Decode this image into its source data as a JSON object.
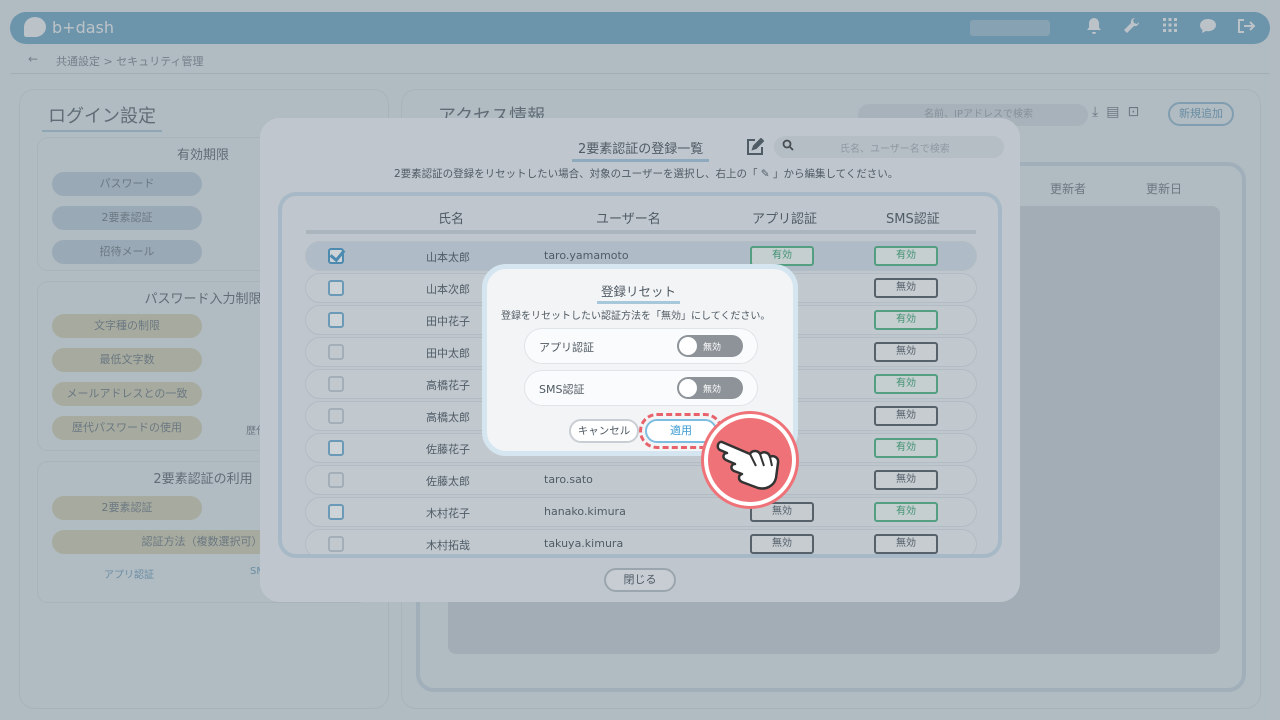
{
  "app": {
    "logo_text": "b+dash"
  },
  "breadcrumb": {
    "back_glyph": "←",
    "text": "共通設定 > セキュリティ管理"
  },
  "top_icons": [
    "bell-icon",
    "wrench-icon",
    "grid-icon",
    "chat-icon",
    "logout-icon"
  ],
  "left_panel": {
    "title": "ログイン設定",
    "groups": [
      {
        "title": "有効期限",
        "rows": [
          "パスワード",
          "2要素認証",
          "招待メール"
        ]
      },
      {
        "title": "パスワード入力制限",
        "rows": [
          "文字種の制限",
          "最低文字数",
          "メールアドレスとの一致",
          "歴代パスワードの使用"
        ],
        "extra": "歴代"
      },
      {
        "title": "2要素認証の利用",
        "rows": [
          "2要素認証"
        ],
        "wide": "認証方法（複数選択可）",
        "options": [
          "アプリ認証",
          "SMS"
        ]
      }
    ]
  },
  "right_panel": {
    "title": "アクセス情報",
    "search_placeholder": "名前、IPアドレスで検索",
    "new_button": "新規追加",
    "headers": [
      "更新者",
      "更新日"
    ]
  },
  "list_modal": {
    "title": "2要素認証の登録一覧",
    "search_placeholder": "氏名、ユーザー名で検索",
    "description": "2要素認証の登録をリセットしたい場合、対象のユーザーを選択し、右上の「 ✎ 」から編集してください。",
    "columns": {
      "name": "氏名",
      "user": "ユーザー名",
      "app": "アプリ認証",
      "sms": "SMS認証"
    },
    "rows": [
      {
        "name": "山本太郎",
        "user": "taro.yamamoto",
        "app": "有効",
        "sms": "有効"
      },
      {
        "name": "山本次郎",
        "user": "",
        "app": "",
        "sms": "無効"
      },
      {
        "name": "田中花子",
        "user": "",
        "app": "",
        "sms": "有効"
      },
      {
        "name": "田中太郎",
        "user": "",
        "app": "",
        "sms": "無効"
      },
      {
        "name": "高橋花子",
        "user": "",
        "app": "",
        "sms": "有効"
      },
      {
        "name": "高橋太郎",
        "user": "",
        "app": "",
        "sms": "無効"
      },
      {
        "name": "佐藤花子",
        "user": "",
        "app": "",
        "sms": "有効"
      },
      {
        "name": "佐藤太郎",
        "user": "taro.sato",
        "app": "",
        "sms": "無効"
      },
      {
        "name": "木村花子",
        "user": "hanako.kimura",
        "app": "無効",
        "sms": "有効"
      },
      {
        "name": "木村拓哉",
        "user": "takuya.kimura",
        "app": "無効",
        "sms": "無効"
      }
    ],
    "close_button": "閉じる"
  },
  "reset_dialog": {
    "title": "登録リセット",
    "description": "登録をリセットしたい認証方法を「無効」にしてください。",
    "options": [
      {
        "label": "アプリ認証",
        "state": "無効"
      },
      {
        "label": "SMS認証",
        "state": "無効"
      }
    ],
    "cancel_button": "キャンセル",
    "apply_button": "適用"
  }
}
